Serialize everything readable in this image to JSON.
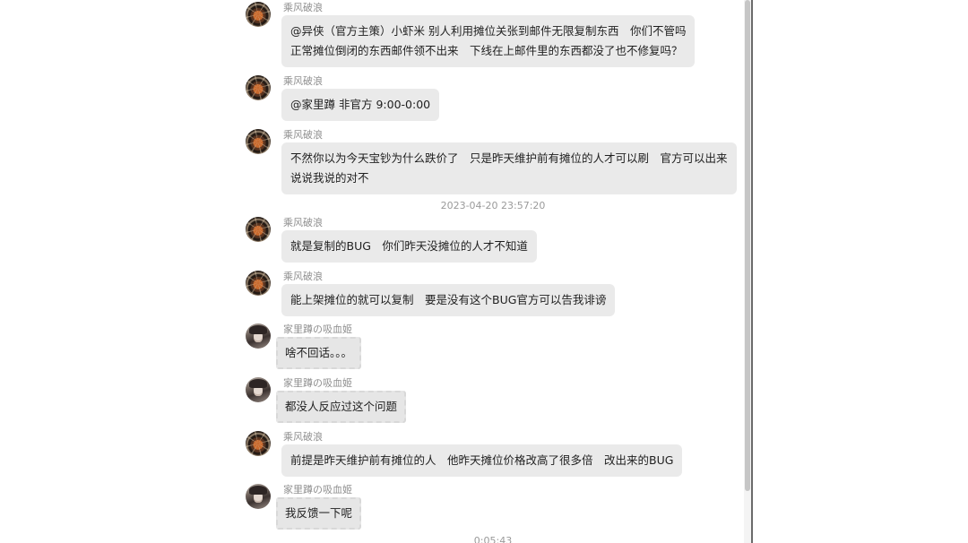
{
  "messages": [
    {
      "sender": "乘风破浪",
      "avatar": "character-avatar-orange",
      "lines": [
        "@异侠（官方主策）小虾米 别人利用摊位关张到邮件无限复制东西　你们不管吗",
        "正常摊位倒闭的东西邮件领不出来　下线在上邮件里的东西都没了也不修复吗？"
      ]
    },
    {
      "sender": "乘风破浪",
      "avatar": "character-avatar-orange",
      "lines": [
        "@家里蹲 非官方 9:00-0:00"
      ]
    },
    {
      "sender": "乘风破浪",
      "avatar": "character-avatar-orange",
      "lines": [
        "不然你以为今天宝钞为什么跌价了　只是昨天维护前有摊位的人才可以刷　官方可以出来",
        "说说我说的对不"
      ]
    },
    {
      "sender": "乘风破浪",
      "avatar": "character-avatar-orange",
      "lines": [
        "就是复制的BUG　你们昨天没摊位的人才不知道"
      ]
    },
    {
      "sender": "乘风破浪",
      "avatar": "character-avatar-orange",
      "lines": [
        "能上架摊位的就可以复制　要是没有这个BUG官方可以告我诽谤"
      ]
    },
    {
      "sender": "家里蹲の吸血姬",
      "avatar": "character-avatar-gothic",
      "lines": [
        "啥不回话。。。"
      ]
    },
    {
      "sender": "家里蹲の吸血姬",
      "avatar": "character-avatar-gothic",
      "lines": [
        "都没人反应过这个问题"
      ]
    },
    {
      "sender": "乘风破浪",
      "avatar": "character-avatar-orange",
      "lines": [
        "前提是昨天维护前有摊位的人　他昨天摊位价格改高了很多倍　改出来的BUG"
      ]
    },
    {
      "sender": "家里蹲の吸血姬",
      "avatar": "character-avatar-gothic",
      "lines": [
        "我反馈一下呢"
      ]
    }
  ],
  "timestamps": [
    "2023-04-20 23:57:20",
    "0:05:43"
  ],
  "colors": {
    "bubble_bg": "#eaeaea",
    "sender_text": "#8f8f8f",
    "message_text": "#1f1f1f",
    "timestamp_text": "#9a9a9a"
  }
}
